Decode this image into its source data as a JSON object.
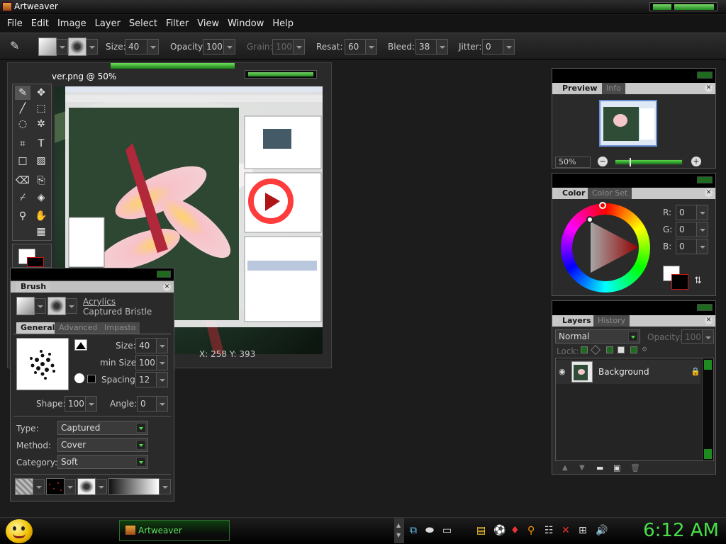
{
  "window": {
    "title": "Artweaver"
  },
  "menu": [
    "File",
    "Edit",
    "Image",
    "Layer",
    "Select",
    "Filter",
    "View",
    "Window",
    "Help"
  ],
  "options": {
    "size_label": "Size:",
    "size_value": "40",
    "opacity_label": "Opacity:",
    "opacity_value": "100",
    "grain_label": "Grain:",
    "grain_value": "100",
    "resat_label": "Resat:",
    "resat_value": "60",
    "bleed_label": "Bleed:",
    "bleed_value": "38",
    "jitter_label": "Jitter:",
    "jitter_value": "0"
  },
  "document": {
    "title": "ver.png @ 50%",
    "status": "X: 258  Y: 393"
  },
  "brush_panel": {
    "tab": "Brush",
    "category_name": "Acrylics",
    "variant_name": "Captured Bristle",
    "tabs": [
      "General",
      "Advanced",
      "Impasto"
    ],
    "size_label": "Size:",
    "size_value": "40",
    "min_size_label": "min Size:",
    "min_size_value": "100",
    "spacing_label": "Spacing:",
    "spacing_value": "12",
    "shape_label": "Shape:",
    "shape_value": "100",
    "angle_label": "Angle:",
    "angle_value": "0",
    "type_label": "Type:",
    "type_value": "Captured",
    "method_label": "Method:",
    "method_value": "Cover",
    "category_label": "Category:",
    "category_value": "Soft"
  },
  "preview_panel": {
    "tabs": [
      "Preview",
      "Info"
    ],
    "zoom": "50%"
  },
  "color_panel": {
    "tabs": [
      "Color",
      "Color Set"
    ],
    "r_label": "R:",
    "r_value": "0",
    "g_label": "G:",
    "g_value": "0",
    "b_label": "B:",
    "b_value": "0"
  },
  "layers_panel": {
    "tabs": [
      "Layers",
      "History"
    ],
    "blend_mode": "Normal",
    "opacity_label": "Opacity:",
    "opacity_value": "100",
    "lock_label": "Lock:",
    "layer_name": "Background"
  },
  "taskbar": {
    "task": "Artweaver",
    "clock": "6:12 AM"
  },
  "colors": {
    "accent": "#46e046",
    "panel": "#2a2a2a",
    "tab_active": "#c5c5c5"
  }
}
